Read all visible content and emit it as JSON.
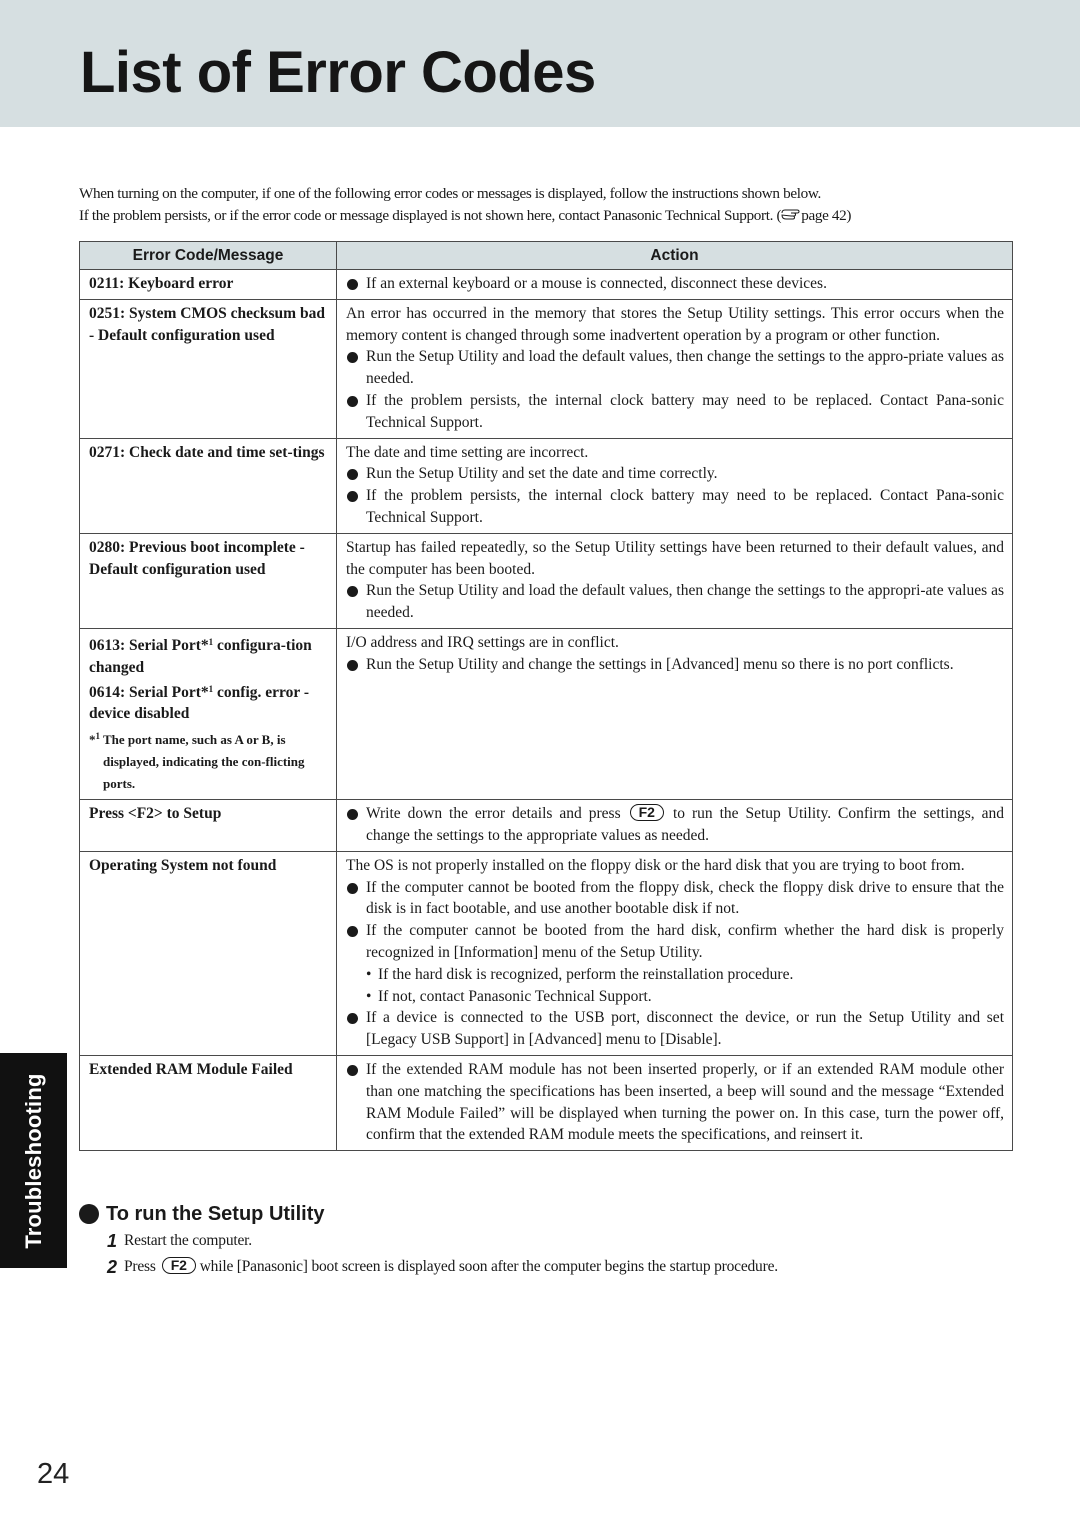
{
  "page": {
    "title": "List of Error Codes",
    "intro_line1": "When turning on the computer, if one of the following error codes or messages is displayed, follow the instructions shown below.",
    "intro_line2": "If the problem persists, or if the error code or message displayed is not shown here, contact Panasonic Technical Support. (",
    "intro_ref_icon": "pointing-hand-icon",
    "intro_ref": "page 42)",
    "side_tab": "Troubleshooting",
    "page_number": "24"
  },
  "table": {
    "headers": [
      "Error Code/Message",
      "Action"
    ],
    "rows": [
      {
        "code_lines": [
          "0211: Keyboard error"
        ],
        "action": [
          {
            "type": "bullet",
            "text": "If an external keyboard or a mouse is connected, disconnect these devices."
          }
        ]
      },
      {
        "code_lines": [
          "0251: System CMOS checksum bad - Default configuration used"
        ],
        "action": [
          {
            "type": "para",
            "text": "An error has occurred in the memory that stores the Setup Utility settings.  This error occurs when the memory content is changed through some inadvertent operation by a program or other function."
          },
          {
            "type": "bullet",
            "text": "Run the Setup Utility and load the default values, then change the settings to the appro-priate values as needed."
          },
          {
            "type": "bullet",
            "text": "If the problem persists, the internal clock battery may need to be replaced. Contact Pana-sonic Technical Support."
          }
        ]
      },
      {
        "code_lines": [
          "0271: Check date and time set-tings"
        ],
        "action": [
          {
            "type": "para",
            "text": "The date and time setting are incorrect."
          },
          {
            "type": "bullet",
            "text": "Run the Setup Utility and set the date and time correctly."
          },
          {
            "type": "bullet",
            "text": "If the problem persists, the internal clock battery may need to be replaced. Contact Pana-sonic Technical Support."
          }
        ]
      },
      {
        "code_lines": [
          "0280: Previous boot incomplete - Default configuration used"
        ],
        "action": [
          {
            "type": "para",
            "text": "Startup has failed repeatedly, so the Setup Utility settings have been returned to their default values, and the computer has been booted."
          },
          {
            "type": "bullet",
            "text": "Run the Setup Utility and load the default values, then change the settings to the appropri-ate values as needed."
          }
        ]
      },
      {
        "code_lines": [
          "0613: Serial Port*1 configura-tion changed",
          "0614: Serial Port*1 config. error - device disabled"
        ],
        "code_note": "*1 The port name, such as A or B, is displayed, indicating the con-flicting ports.",
        "action": [
          {
            "type": "para",
            "text": "I/O address and IRQ settings are in conflict."
          },
          {
            "type": "bullet",
            "text": "Run the Setup Utility and change the settings in [Advanced] menu so there is no port conflicts."
          }
        ]
      },
      {
        "code_lines": [
          "Press <F2> to Setup"
        ],
        "action": [
          {
            "type": "bullet_key",
            "before": "Write down the error details and press",
            "key": "F2",
            "after": "to run the Setup Utility. Confirm the settings, and change the settings to the appropriate values as needed."
          }
        ]
      },
      {
        "code_lines": [
          "Operating System not found"
        ],
        "action": [
          {
            "type": "para",
            "text": "The OS is not properly installed on the floppy disk or the hard disk that you are trying to boot from."
          },
          {
            "type": "bullet",
            "text": "If the computer cannot be booted from the floppy disk, check the floppy disk drive to ensure that the disk is in fact bootable, and use another bootable disk if not."
          },
          {
            "type": "bullet",
            "text": "If the computer cannot be booted from the hard disk, confirm whether the hard disk is properly recognized in [Information] menu of the Setup Utility."
          },
          {
            "type": "sub",
            "text": "If the hard disk is recognized, perform the reinstallation procedure."
          },
          {
            "type": "sub",
            "text": "If not, contact Panasonic Technical Support."
          },
          {
            "type": "bullet",
            "text": "If a device is connected to the USB port, disconnect the device, or run the Setup Utility and set [Legacy USB Support] in [Advanced] menu to [Disable]."
          }
        ]
      },
      {
        "code_lines": [
          "Extended RAM Module Failed"
        ],
        "action": [
          {
            "type": "bullet",
            "text": "If the extended RAM module has not been inserted properly, or if an extended RAM module other than one matching the specifications has been inserted, a beep will sound and the message “Extended RAM Module Failed” will be displayed when turning the power on. In this case, turn the power off, confirm that the extended RAM module meets the specifications, and reinsert it."
          }
        ]
      }
    ]
  },
  "setup": {
    "heading": "To run the Setup Utility",
    "steps": [
      {
        "num": "1",
        "text": "Restart the computer."
      },
      {
        "num": "2",
        "before": "Press",
        "key": "F2",
        "after": "while [Panasonic] boot screen is displayed soon after the computer begins the startup procedure."
      }
    ]
  }
}
